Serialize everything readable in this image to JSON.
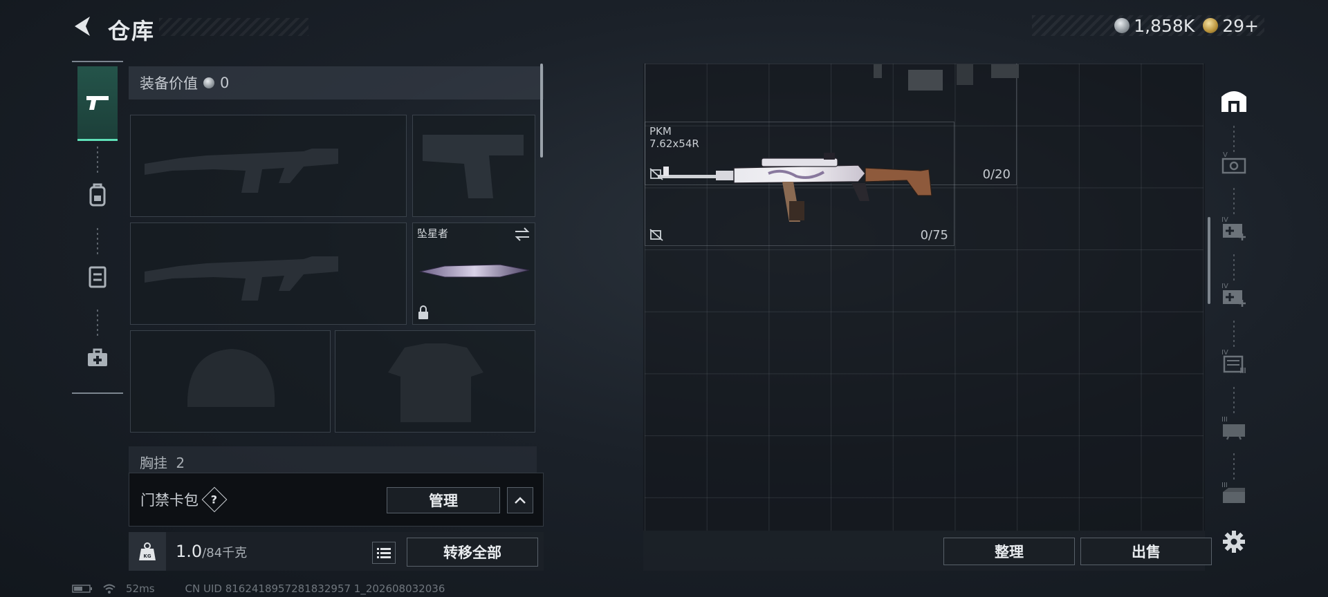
{
  "header": {
    "title": "仓库",
    "currencies": [
      {
        "icon": "silver-coin-icon",
        "amount": "1,858K"
      },
      {
        "icon": "gold-coin-icon",
        "amount": "29+"
      }
    ]
  },
  "categories": [
    {
      "icon": "pistol-icon",
      "active": true
    },
    {
      "icon": "backpack-icon",
      "active": false
    },
    {
      "icon": "chest-rig-icon",
      "active": false
    },
    {
      "icon": "medkit-icon",
      "active": false
    }
  ],
  "equipment": {
    "value_label": "装备价值",
    "value": "0",
    "melee_name": "坠星者",
    "rig_label": "胸挂",
    "rig_count": "2"
  },
  "keycard": {
    "label": "门禁卡包",
    "help": "?",
    "manage_label": "管理"
  },
  "weight": {
    "current": "1.0",
    "max": "/84千克",
    "icon_text": "KG",
    "transfer_label": "转移全部"
  },
  "stash": {
    "items": [
      {
        "name": "",
        "caliber": "",
        "count": "0/20"
      },
      {
        "name": "PKM",
        "caliber": "7.62x54R",
        "count": "0/75"
      }
    ],
    "sort_label": "整理",
    "sell_label": "出售"
  },
  "containers": [
    {
      "icon": "stash-home-icon",
      "tier": ""
    },
    {
      "icon": "weapon-case-icon",
      "tier": "V"
    },
    {
      "icon": "medical-case-icon",
      "tier": "IV"
    },
    {
      "icon": "medical-case-icon",
      "tier": "IV"
    },
    {
      "icon": "document-case-icon",
      "tier": "IV"
    },
    {
      "icon": "weapon-case-icon",
      "tier": "III"
    },
    {
      "icon": "ammo-case-icon",
      "tier": "III"
    }
  ],
  "status": {
    "ping": "52ms",
    "uid": "CN UID 8162418957281832957 1_202608032036"
  },
  "colors": {
    "accent_active": "#5fe0b8",
    "background": "#1b2129"
  }
}
